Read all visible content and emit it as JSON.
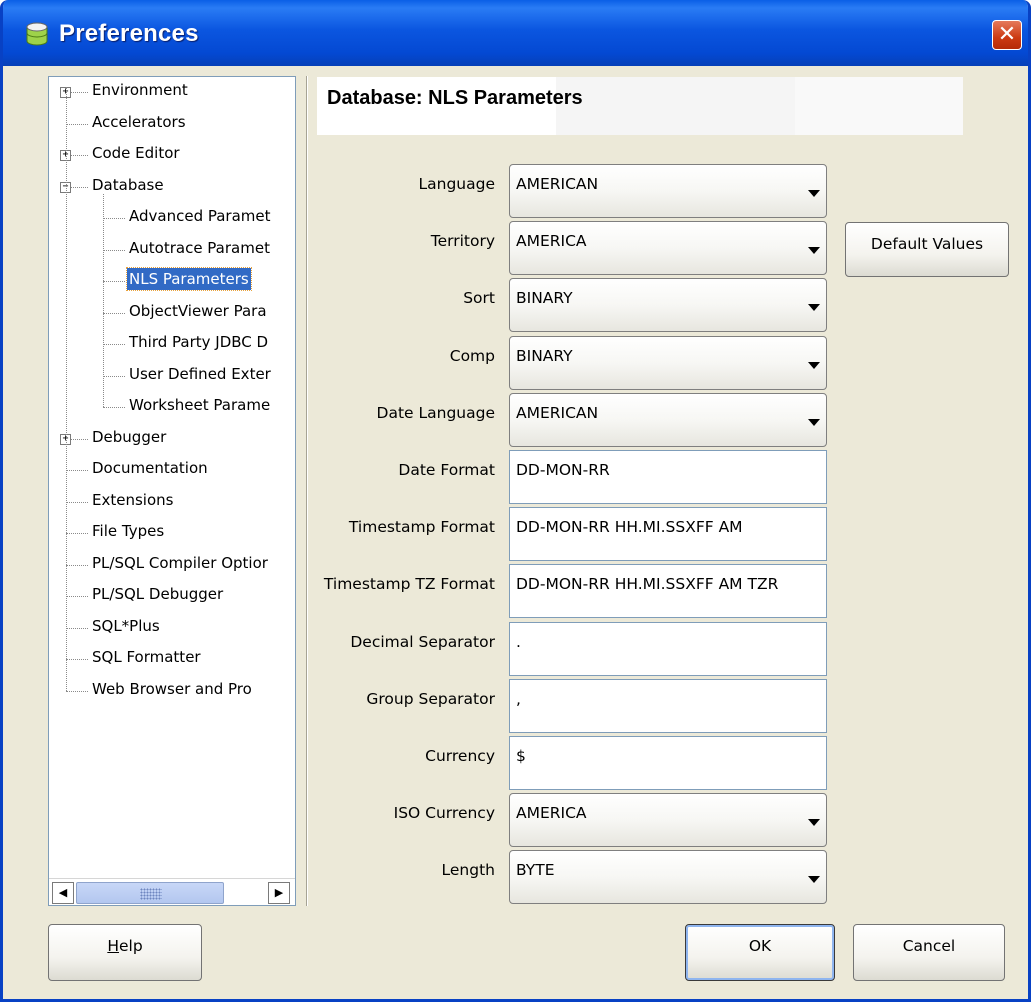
{
  "window": {
    "title": "Preferences",
    "close_glyph": "✕"
  },
  "tree": {
    "items": [
      {
        "label": "Environment",
        "expander": "+"
      },
      {
        "label": "Accelerators",
        "expander": ""
      },
      {
        "label": "Code Editor",
        "expander": "+"
      },
      {
        "label": "Database",
        "expander": "−"
      },
      {
        "label": "Advanced Paramet",
        "expander": ""
      },
      {
        "label": "Autotrace Paramet",
        "expander": ""
      },
      {
        "label": "NLS Parameters",
        "expander": "",
        "selected": true
      },
      {
        "label": "ObjectViewer Para",
        "expander": ""
      },
      {
        "label": "Third Party JDBC D",
        "expander": ""
      },
      {
        "label": "User Defined Exter",
        "expander": ""
      },
      {
        "label": "Worksheet Parame",
        "expander": ""
      },
      {
        "label": "Debugger",
        "expander": "+"
      },
      {
        "label": "Documentation",
        "expander": ""
      },
      {
        "label": "Extensions",
        "expander": ""
      },
      {
        "label": "File Types",
        "expander": ""
      },
      {
        "label": "PL/SQL Compiler Optior",
        "expander": ""
      },
      {
        "label": "PL/SQL Debugger",
        "expander": ""
      },
      {
        "label": "SQL*Plus",
        "expander": ""
      },
      {
        "label": "SQL Formatter",
        "expander": ""
      },
      {
        "label": "Web Browser and Pro",
        "expander": ""
      }
    ],
    "scroll_left_glyph": "◀",
    "scroll_right_glyph": "▶"
  },
  "page": {
    "title": "Database: NLS Parameters"
  },
  "fields": [
    {
      "label": "Language",
      "value": "AMERICAN",
      "kind": "combo"
    },
    {
      "label": "Territory",
      "value": "AMERICA",
      "kind": "combo"
    },
    {
      "label": "Sort",
      "value": "BINARY",
      "kind": "combo"
    },
    {
      "label": "Comp",
      "value": "BINARY",
      "kind": "combo"
    },
    {
      "label": "Date Language",
      "value": "AMERICAN",
      "kind": "combo"
    },
    {
      "label": "Date Format",
      "value": "DD-MON-RR",
      "kind": "text"
    },
    {
      "label": "Timestamp Format",
      "value": "DD-MON-RR HH.MI.SSXFF AM",
      "kind": "text"
    },
    {
      "label": "Timestamp TZ Format",
      "value": "DD-MON-RR HH.MI.SSXFF AM TZR",
      "kind": "text"
    },
    {
      "label": "Decimal Separator",
      "value": ".",
      "kind": "text"
    },
    {
      "label": "Group Separator",
      "value": ",",
      "kind": "text"
    },
    {
      "label": "Currency",
      "value": "$",
      "kind": "text"
    },
    {
      "label": "ISO Currency",
      "value": "AMERICA",
      "kind": "combo"
    },
    {
      "label": "Length",
      "value": "BYTE",
      "kind": "combo"
    }
  ],
  "buttons": {
    "default_values": "Default Values",
    "help_mnemonic": "H",
    "help_rest": "elp",
    "ok": "OK",
    "cancel": "Cancel"
  }
}
